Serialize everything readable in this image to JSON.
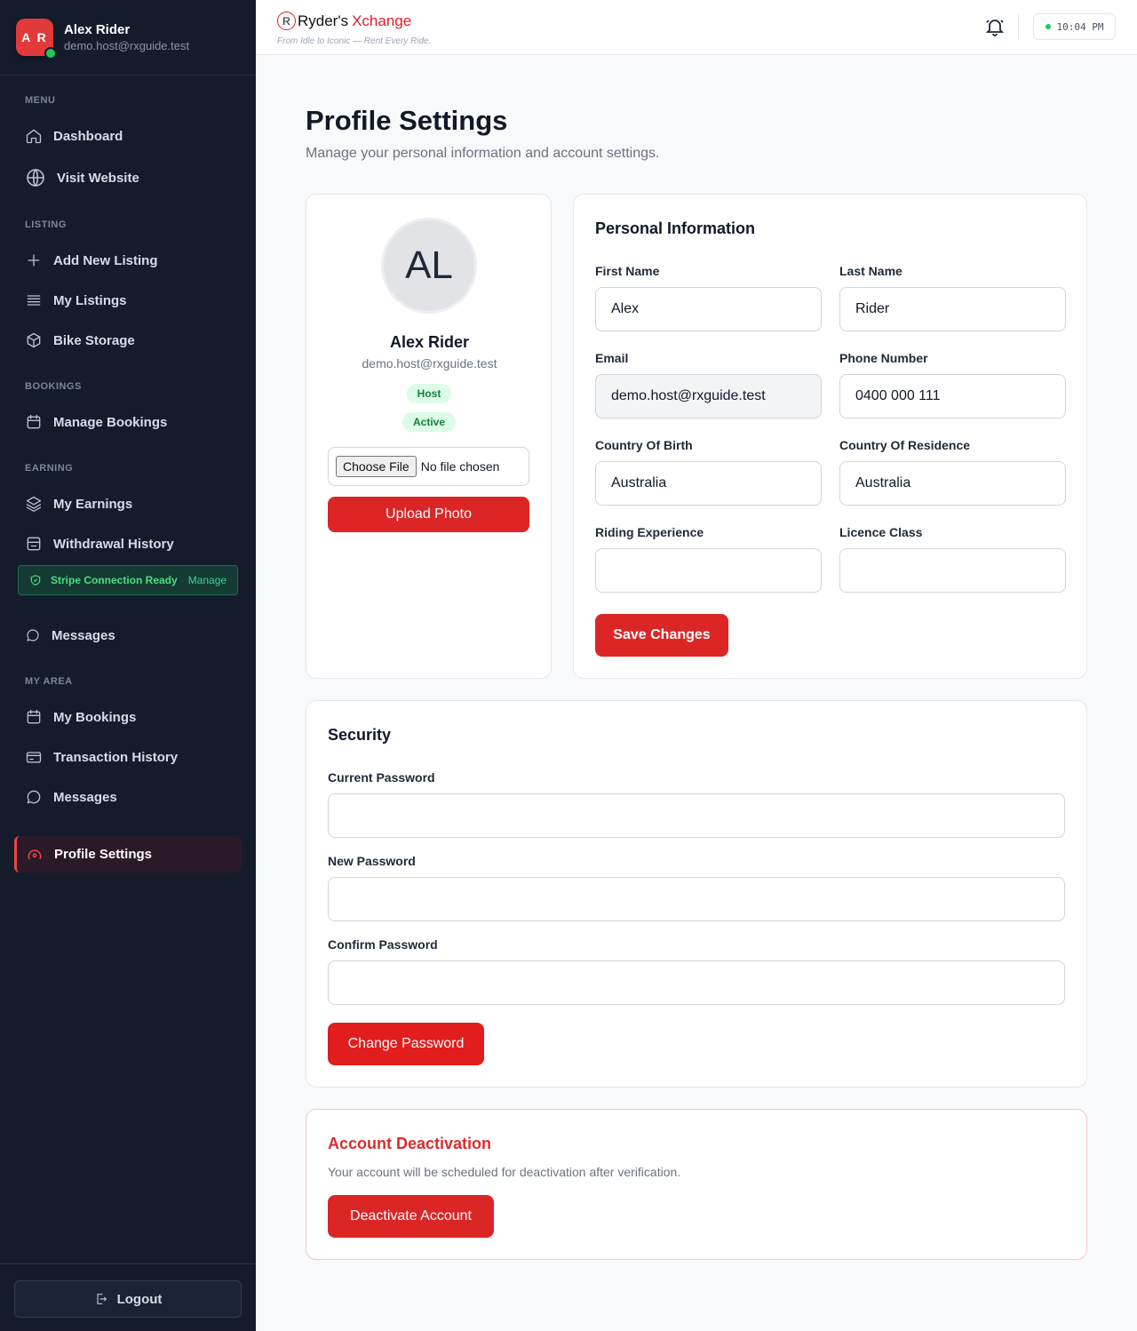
{
  "user": {
    "initials": "A R",
    "name": "Alex Rider",
    "email": "demo.host@rxguide.test"
  },
  "sidebar": {
    "sections": {
      "menu": "MENU",
      "listing": "LISTING",
      "bookings": "BOOKINGS",
      "earning": "EARNING",
      "my_area": "MY AREA"
    },
    "items": {
      "dashboard": "Dashboard",
      "visit_website": "Visit Website",
      "add_listing": "Add New Listing",
      "my_listings": "My Listings",
      "bike_storage": "Bike Storage",
      "manage_bookings": "Manage Bookings",
      "my_earnings": "My Earnings",
      "withdrawal_history": "Withdrawal History",
      "messages_host": "Messages",
      "my_bookings": "My Bookings",
      "transaction_history": "Transaction History",
      "messages_user": "Messages",
      "profile_settings": "Profile Settings"
    },
    "stripe": {
      "status": "Stripe Connection Ready",
      "manage": "Manage"
    },
    "logout": "Logout"
  },
  "header": {
    "brand_mark": "R",
    "brand_part1": "Ryder's",
    "brand_part2": "Xchange",
    "tagline": "From Idle to Iconic — Rent Every Ride.",
    "time": "10:04 PM"
  },
  "page": {
    "title": "Profile Settings",
    "subtitle": "Manage your personal information and account settings."
  },
  "avatar_card": {
    "initials": "AL",
    "name": "Alex Rider",
    "email": "demo.host@rxguide.test",
    "badge_role": "Host",
    "badge_status": "Active",
    "file_button": "Choose File",
    "file_status": "No file chosen",
    "upload_button": "Upload Photo"
  },
  "personal": {
    "title": "Personal Information",
    "first_name_label": "First Name",
    "first_name": "Alex",
    "last_name_label": "Last Name",
    "last_name": "Rider",
    "email_label": "Email",
    "email": "demo.host@rxguide.test",
    "phone_label": "Phone Number",
    "phone": "0400 000 111",
    "country_birth_label": "Country Of Birth",
    "country_birth": "Australia",
    "country_residence_label": "Country Of Residence",
    "country_residence": "Australia",
    "riding_experience_label": "Riding Experience",
    "riding_experience": "",
    "licence_class_label": "Licence Class",
    "licence_class": "",
    "save_button": "Save Changes"
  },
  "security": {
    "title": "Security",
    "current_label": "Current Password",
    "new_label": "New Password",
    "confirm_label": "Confirm Password",
    "change_button": "Change Password"
  },
  "deactivation": {
    "title": "Account Deactivation",
    "text": "Your account will be scheduled for deactivation after verification.",
    "button": "Deactivate Account"
  },
  "colors": {
    "sidebar_bg": "#141c2c",
    "accent_red": "#dc2626",
    "success_green": "#22c55e"
  }
}
